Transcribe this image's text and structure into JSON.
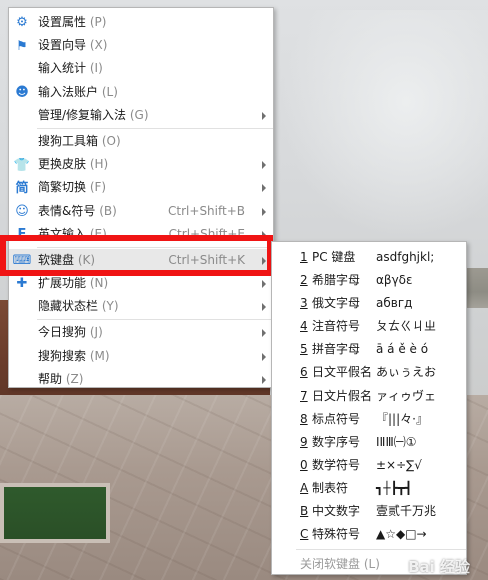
{
  "menu": {
    "items": [
      {
        "icon": "gear-icon",
        "glyph": "⚙",
        "label": "设置属性",
        "accel": "(P)",
        "shortcut": "",
        "submenu": false
      },
      {
        "icon": "flag-icon",
        "glyph": "⚑",
        "label": "设置向导",
        "accel": "(X)",
        "shortcut": "",
        "submenu": false
      },
      {
        "icon": "",
        "glyph": "",
        "label": "输入统计",
        "accel": "(I)",
        "shortcut": "",
        "submenu": false
      },
      {
        "icon": "user-icon",
        "glyph": "☻",
        "label": "输入法账户",
        "accel": "(L)",
        "shortcut": "",
        "submenu": false
      },
      {
        "icon": "",
        "glyph": "",
        "label": "管理/修复输入法",
        "accel": "(G)",
        "shortcut": "",
        "submenu": true
      },
      {
        "icon": "",
        "glyph": "",
        "label": "搜狗工具箱",
        "accel": "(O)",
        "shortcut": "",
        "submenu": false
      },
      {
        "icon": "shirt-icon",
        "glyph": "👕",
        "label": "更换皮肤",
        "accel": "(H)",
        "shortcut": "",
        "submenu": true
      },
      {
        "icon": "simplified-traditional-icon",
        "glyph": "简",
        "label": "简繁切换",
        "accel": "(F)",
        "shortcut": "",
        "submenu": true
      },
      {
        "icon": "smiley-icon",
        "glyph": "☺",
        "label": "表情&符号",
        "accel": "(B)",
        "shortcut": "Ctrl+Shift+B",
        "submenu": true
      },
      {
        "icon": "english-icon",
        "glyph": "E",
        "label": "英文输入",
        "accel": "(E)",
        "shortcut": "Ctrl+Shift+E",
        "submenu": true
      },
      {
        "icon": "keyboard-icon",
        "glyph": "⌨",
        "label": "软键盘",
        "accel": "(K)",
        "shortcut": "Ctrl+Shift+K",
        "submenu": true
      },
      {
        "icon": "puzzle-icon",
        "glyph": "✚",
        "label": "扩展功能",
        "accel": "(N)",
        "shortcut": "",
        "submenu": true
      },
      {
        "icon": "",
        "glyph": "",
        "label": "隐藏状态栏",
        "accel": "(Y)",
        "shortcut": "",
        "submenu": true
      },
      {
        "icon": "",
        "glyph": "",
        "label": "今日搜狗",
        "accel": "(J)",
        "shortcut": "",
        "submenu": true
      },
      {
        "icon": "",
        "glyph": "",
        "label": "搜狗搜索",
        "accel": "(M)",
        "shortcut": "",
        "submenu": true
      },
      {
        "icon": "",
        "glyph": "",
        "label": "帮助",
        "accel": "(Z)",
        "shortcut": "",
        "submenu": true
      }
    ]
  },
  "softkeyboard": {
    "items": [
      {
        "key": "1",
        "name": "PC 键盘",
        "sample": "asdfghjkl;"
      },
      {
        "key": "2",
        "name": "希腊字母",
        "sample": "αβγδε"
      },
      {
        "key": "3",
        "name": "俄文字母",
        "sample": "абвгд"
      },
      {
        "key": "4",
        "name": "注音符号",
        "sample": "ㄆㄊㄍㄐㄓ"
      },
      {
        "key": "5",
        "name": "拼音字母",
        "sample": "ā á ě è ó"
      },
      {
        "key": "6",
        "name": "日文平假名",
        "sample": "あぃぅえお"
      },
      {
        "key": "7",
        "name": "日文片假名",
        "sample": "ァィゥヴェ"
      },
      {
        "key": "8",
        "name": "标点符号",
        "sample": "『|||々·』"
      },
      {
        "key": "9",
        "name": "数字序号",
        "sample": "ⅠⅡⅢ㈠①"
      },
      {
        "key": "0",
        "name": "数学符号",
        "sample": "±×÷∑√"
      },
      {
        "key": "A",
        "name": "制表符",
        "sample": "┓┼┣┳┫"
      },
      {
        "key": "B",
        "name": "中文数字",
        "sample": "壹贰千万兆"
      },
      {
        "key": "C",
        "name": "特殊符号",
        "sample": "▲☆◆□→"
      }
    ],
    "close_label": "关闭软键盘",
    "close_accel": "(L)"
  },
  "watermark": "Bai 经验"
}
